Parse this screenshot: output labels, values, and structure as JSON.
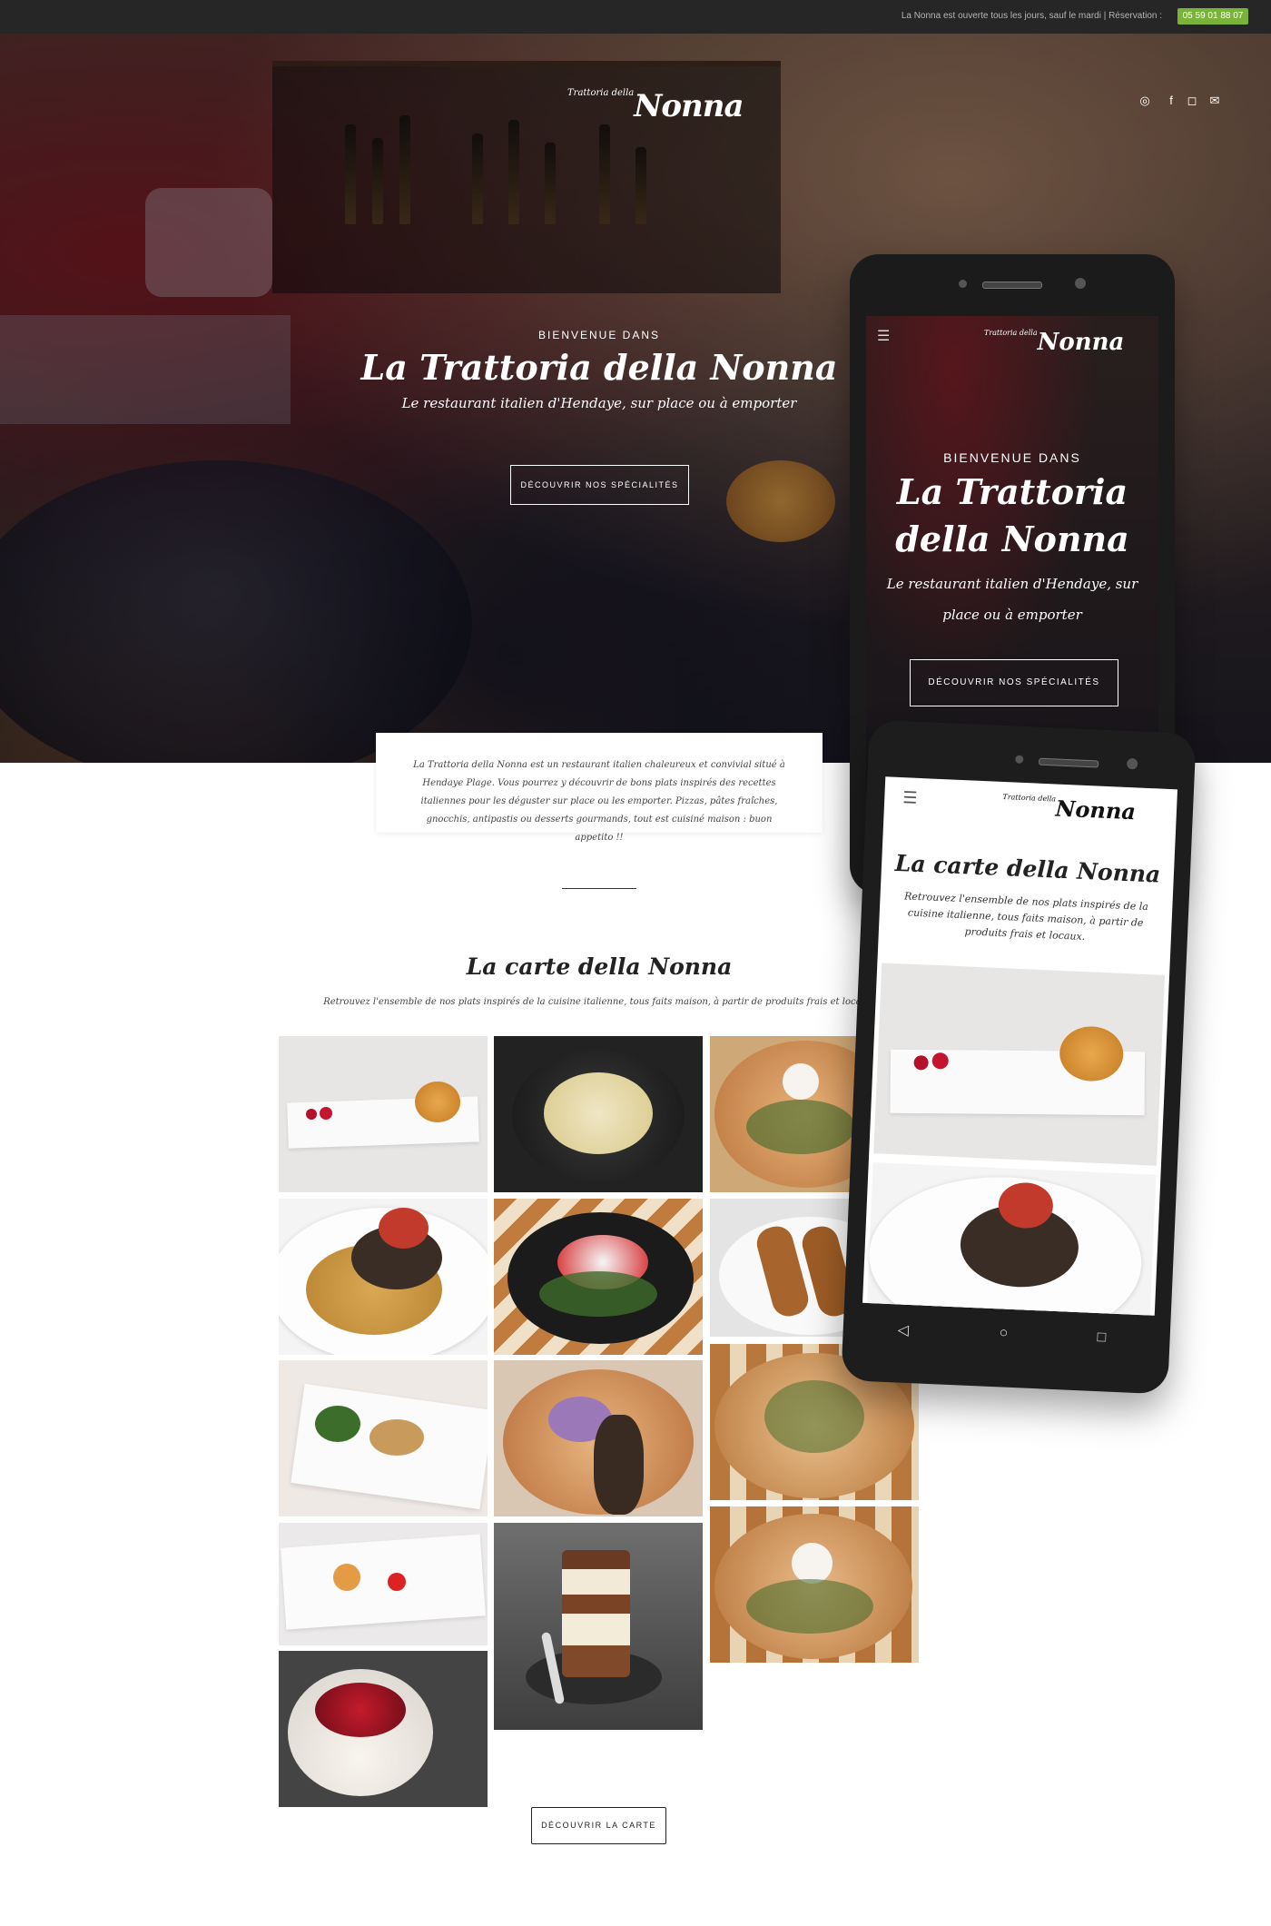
{
  "topbar": {
    "info": "La Nonna est ouverte tous  les jours, sauf le mardi | Réservation :",
    "phone": "05 59 01 88 07"
  },
  "brand": {
    "logo_small": "Trattoria della",
    "logo_main": "Nonna"
  },
  "social": [
    "tripadvisor-icon",
    "facebook-icon",
    "instagram-icon",
    "mail-icon"
  ],
  "hero": {
    "kicker": "BIENVENUE DANS",
    "title": "La Trattoria della Nonna",
    "subtitle": "Le restaurant italien d'Hendaye, sur place ou à emporter",
    "button": "DÉCOUVRIR NOS SPÉCIALITÉS"
  },
  "intro": {
    "text": "La Trattoria della Nonna est un restaurant italien chaleureux et convivial situé à Hendaye Plage. Vous pourrez y découvrir de bons plats inspirés des recettes italiennes pour les déguster sur place ou les emporter. Pizzas, pâtes fraîches, gnocchis, antipastis ou desserts gourmands, tout est cuisiné maison : buon appetito !!"
  },
  "carte": {
    "title": "La carte della Nonna",
    "subtitle": "Retrouvez l'ensemble de nos plats inspirés de la cuisine italienne, tous faits maison, à partir de produits frais et locaux.",
    "button": "DÉCOUVRIR LA CARTE"
  },
  "phone1": {
    "kicker": "BIENVENUE DANS",
    "title_line1": "La Trattoria",
    "title_line2": "della Nonna",
    "subtitle_line1": "Le restaurant italien d'Hendaye, sur",
    "subtitle_line2": "place ou à emporter",
    "button": "DÉCOUVRIR NOS SPÉCIALITÉS"
  },
  "phone2": {
    "title": "La carte della Nonna",
    "subtitle_line1": "Retrouvez l'ensemble de nos plats inspirés de la",
    "subtitle_line2": "cuisine italienne, tous faits maison, à partir de",
    "subtitle_line3": "produits frais et locaux."
  },
  "colors": {
    "topbar": "#262626",
    "accent_green": "#7ab33a",
    "text_dark": "#222222"
  }
}
